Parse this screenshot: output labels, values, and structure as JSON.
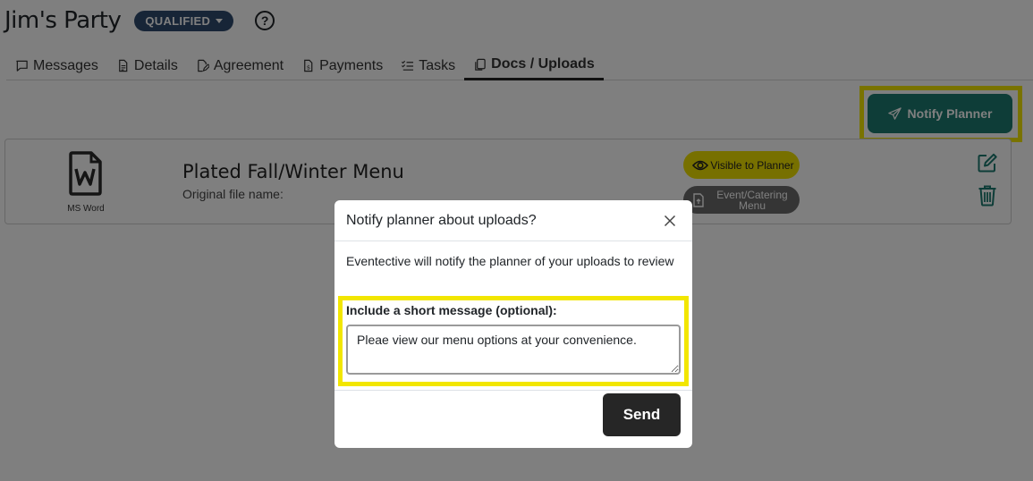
{
  "header": {
    "title": "Jim's Party",
    "status": "QUALIFIED",
    "help": "?"
  },
  "tabs": [
    {
      "label": "Messages",
      "icon": "chat-icon"
    },
    {
      "label": "Details",
      "icon": "file-icon"
    },
    {
      "label": "Agreement",
      "icon": "pen-icon"
    },
    {
      "label": "Payments",
      "icon": "invoice-icon"
    },
    {
      "label": "Tasks",
      "icon": "checklist-icon"
    },
    {
      "label": "Docs / Uploads",
      "icon": "copy-icon",
      "active": true
    }
  ],
  "actions": {
    "notify_label": "Notify Planner"
  },
  "document": {
    "title": "Plated Fall/Winter Menu",
    "original_file_label": "Original file name:",
    "file_type": "MS Word",
    "visibility_badge": "Visible to Planner",
    "category_badge": "Event/Catering Menu"
  },
  "modal": {
    "title": "Notify planner about uploads?",
    "description": "Eventective will notify the planner of your uploads to review",
    "message_label": "Include a short message (optional):",
    "message_value": "Pleae view our menu options at your convenience.",
    "send_label": "Send"
  },
  "colors": {
    "primary": "#1d7a70",
    "status_pill": "#2f4a6e",
    "highlight": "#f2e600",
    "badge_visible": "#eee100",
    "badge_type": "#6a6a6a",
    "send_button": "#262626"
  }
}
